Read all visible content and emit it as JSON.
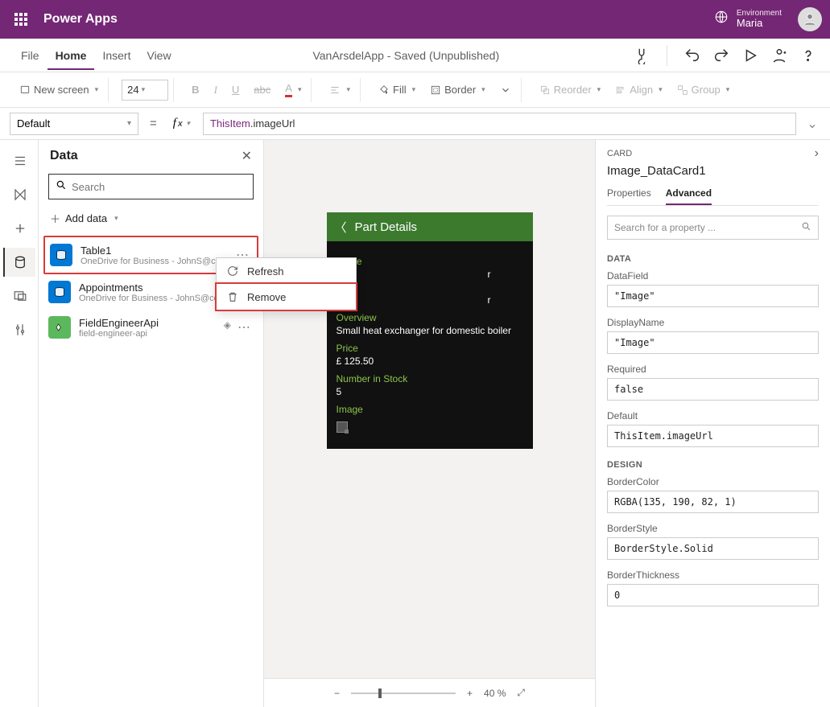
{
  "titlebar": {
    "app_title": "Power Apps",
    "env_label": "Environment",
    "env_name": "Maria"
  },
  "menubar": {
    "items": [
      "File",
      "Home",
      "Insert",
      "View"
    ],
    "active_index": 1,
    "center": "VanArsdelApp - Saved (Unpublished)"
  },
  "toolbar": {
    "new_screen": "New screen",
    "font_size": "24",
    "fill": "Fill",
    "border": "Border",
    "reorder": "Reorder",
    "align": "Align",
    "group": "Group"
  },
  "formulabar": {
    "property": "Default",
    "tokens": {
      "this": "ThisItem",
      "dot": ".",
      "prop": "imageUrl"
    }
  },
  "datapanel": {
    "title": "Data",
    "search_placeholder": "Search",
    "add_data": "Add data",
    "items": [
      {
        "name": "Table1",
        "sub": "OneDrive for Business - JohnS@conten..",
        "icon": "excel",
        "highlight": true
      },
      {
        "name": "Appointments",
        "sub": "OneDrive for Business - JohnS@conten..",
        "icon": "excel",
        "highlight": false
      },
      {
        "name": "FieldEngineerApi",
        "sub": "field-engineer-api",
        "icon": "api",
        "highlight": false,
        "premium": true
      }
    ],
    "context_menu": {
      "refresh": "Refresh",
      "remove": "Remove"
    }
  },
  "canvas": {
    "header_title": "Part Details",
    "fields": [
      {
        "label": "Name",
        "value": "r"
      },
      {
        "label": "",
        "value": "r"
      },
      {
        "label": "Overview",
        "value": "Small heat exchanger for domestic boiler"
      },
      {
        "label": "Price",
        "value": "£ 125.50"
      },
      {
        "label": "Number in Stock",
        "value": "5"
      },
      {
        "label": "Image",
        "value": ""
      }
    ]
  },
  "zoom": {
    "value": "40",
    "unit": "%"
  },
  "props": {
    "crumb": "CARD",
    "card_name": "Image_DataCard1",
    "tabs": [
      "Properties",
      "Advanced"
    ],
    "active_tab": 1,
    "search_placeholder": "Search for a property ...",
    "sections": {
      "data": "DATA",
      "design": "DESIGN"
    },
    "fields": [
      {
        "section": "data",
        "label": "DataField",
        "value": "\"Image\""
      },
      {
        "section": "data",
        "label": "DisplayName",
        "value": "\"Image\""
      },
      {
        "section": "data",
        "label": "Required",
        "value": "false"
      },
      {
        "section": "data",
        "label": "Default",
        "value": "ThisItem.imageUrl"
      },
      {
        "section": "design",
        "label": "BorderColor",
        "value": "RGBA(135, 190, 82, 1)"
      },
      {
        "section": "design",
        "label": "BorderStyle",
        "value": "BorderStyle.Solid"
      },
      {
        "section": "design",
        "label": "BorderThickness",
        "value": "0"
      }
    ]
  }
}
